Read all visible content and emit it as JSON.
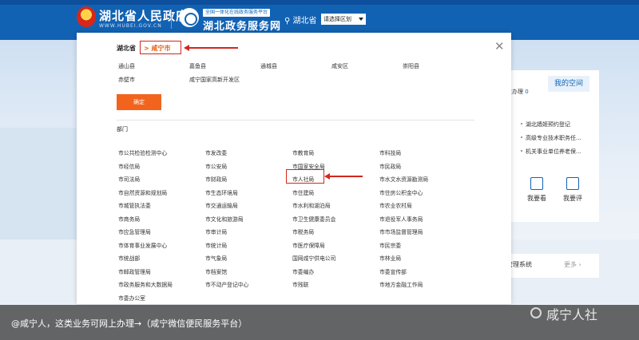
{
  "header": {
    "gov_title": "湖北省人民政府",
    "gov_domain": "WWW.HUBEI.GOV.CN",
    "service_badge": "全国一体化在线政务服务平台",
    "service_title": "湖北政务服务网",
    "location": "湖北省",
    "region_select": "请选择区划",
    "brand_color": "#1262b3"
  },
  "side_panel": {
    "my_space": "我的空间",
    "online_label": "在办理",
    "online_count": "0",
    "news": [
      "湖北嫱姬预约登记",
      "高级专业技术职务任...",
      "机关事业单位养老保..."
    ],
    "actions": [
      "我要看",
      "我要评"
    ],
    "system_label": "管理系统",
    "more": "更多"
  },
  "modal": {
    "breadcrumb_province": "湖北省",
    "breadcrumb_city": "> 咸宁市",
    "counties": [
      "通山县",
      "嘉鱼县",
      "通城县",
      "咸安区",
      "崇阳县",
      "赤壁市",
      "咸宁国家高新开发区"
    ],
    "confirm_label": "确定",
    "departments_title": "部门",
    "departments": [
      "市公共检验检测中心",
      "市发改委",
      "市教育局",
      "市科技局",
      "市经信局",
      "市公安局",
      "市国家安全局",
      "市民政局",
      "市司法局",
      "市财政局",
      "市人社局",
      "市水文水资源勘测局",
      "市自然资源和规划局",
      "市生态环境局",
      "市住建局",
      "市住房公积金中心",
      "市城管执法委",
      "市交通运输局",
      "市水利和湖泊局",
      "市农业农村局",
      "市商务局",
      "市文化和旅游局",
      "市卫生健康委员会",
      "市退役军人事务局",
      "市应急管理局",
      "市审计局",
      "市税务局",
      "市市场监督管理局",
      "市体育事业发展中心",
      "市统计局",
      "市医疗保障局",
      "市民宗委",
      "市统战部",
      "市气象局",
      "国网咸宁供电公司",
      "市林业局",
      "市邮政管理局",
      "市档案馆",
      "市委编办",
      "市委宣传部",
      "市政务服务和大数据局",
      "市不动产登记中心",
      "市残联",
      "市地方金融工作局",
      "市委办公室"
    ],
    "highlighted_department": "市人社局",
    "accent_color": "#f2641e",
    "highlight_color": "#d0281e"
  },
  "caption": {
    "text": "@咸宁人，这类业务可网上办理→（咸宁微信便民服务平台）",
    "watermark": "咸宁人社"
  }
}
